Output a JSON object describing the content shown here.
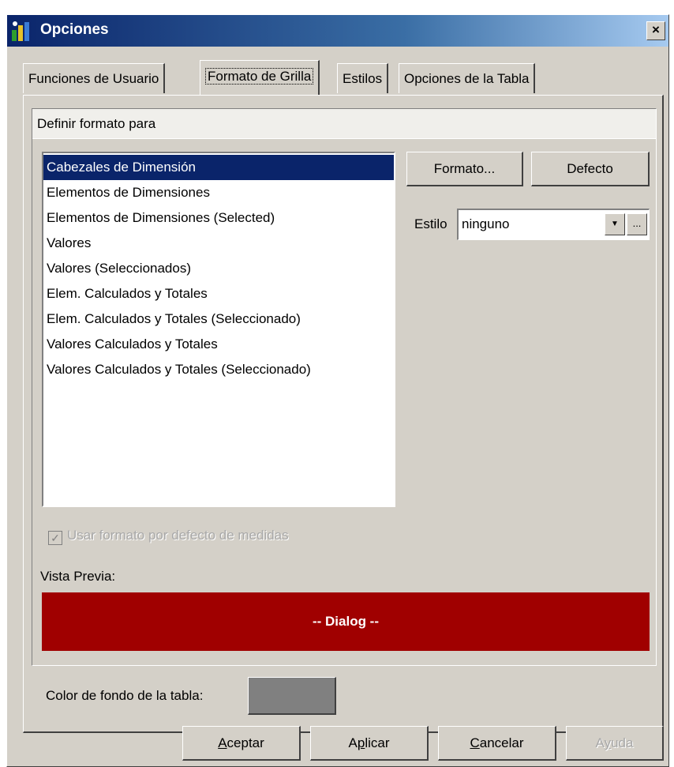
{
  "window": {
    "title": "Opciones",
    "close_glyph": "×"
  },
  "tabs": [
    {
      "label": "Funciones de Usuario"
    },
    {
      "label": "Formato de Grilla",
      "active": true
    },
    {
      "label": "Estilos"
    },
    {
      "label": "Opciones de la Tabla"
    }
  ],
  "format_group": {
    "header": "Definir formato para",
    "items": [
      {
        "label": "Cabezales de Dimensión",
        "selected": true
      },
      {
        "label": "Elementos de Dimensiones"
      },
      {
        "label": "Elementos de Dimensiones (Selected)"
      },
      {
        "label": "Valores"
      },
      {
        "label": "Valores (Seleccionados)"
      },
      {
        "label": "Elem. Calculados y Totales"
      },
      {
        "label": "Elem. Calculados y Totales (Seleccionado)"
      },
      {
        "label": "Valores Calculados y Totales"
      },
      {
        "label": "Valores Calculados y Totales (Seleccionado)"
      }
    ],
    "format_button": "Formato...",
    "default_button": "Defecto",
    "style_label": "Estilo",
    "style_value": "ninguno",
    "style_dropdown_glyph": "▼",
    "style_browse_glyph": "...",
    "use_default_checkbox": {
      "label": "Usar formato por defecto de medidas",
      "checked": true,
      "disabled": true
    },
    "preview_label": "Vista Previa:",
    "preview_text": "-- Dialog --"
  },
  "table_background": {
    "label": "Color de fondo de la tabla:",
    "color": "#808080"
  },
  "buttons": {
    "accept": {
      "prefix": "",
      "mnemonic": "A",
      "rest": "ceptar"
    },
    "apply": {
      "prefix": "A",
      "mnemonic": "p",
      "rest": "licar"
    },
    "cancel": {
      "prefix": "",
      "mnemonic": "C",
      "rest": "ancelar"
    },
    "help": {
      "prefix": "A",
      "mnemonic": "y",
      "rest": "uda",
      "disabled": true
    }
  },
  "colors": {
    "dialog_bg": "#d4d0c8",
    "selection": "#0a246a",
    "preview_bg": "#a00000",
    "title_gradient_start": "#0a246a"
  }
}
